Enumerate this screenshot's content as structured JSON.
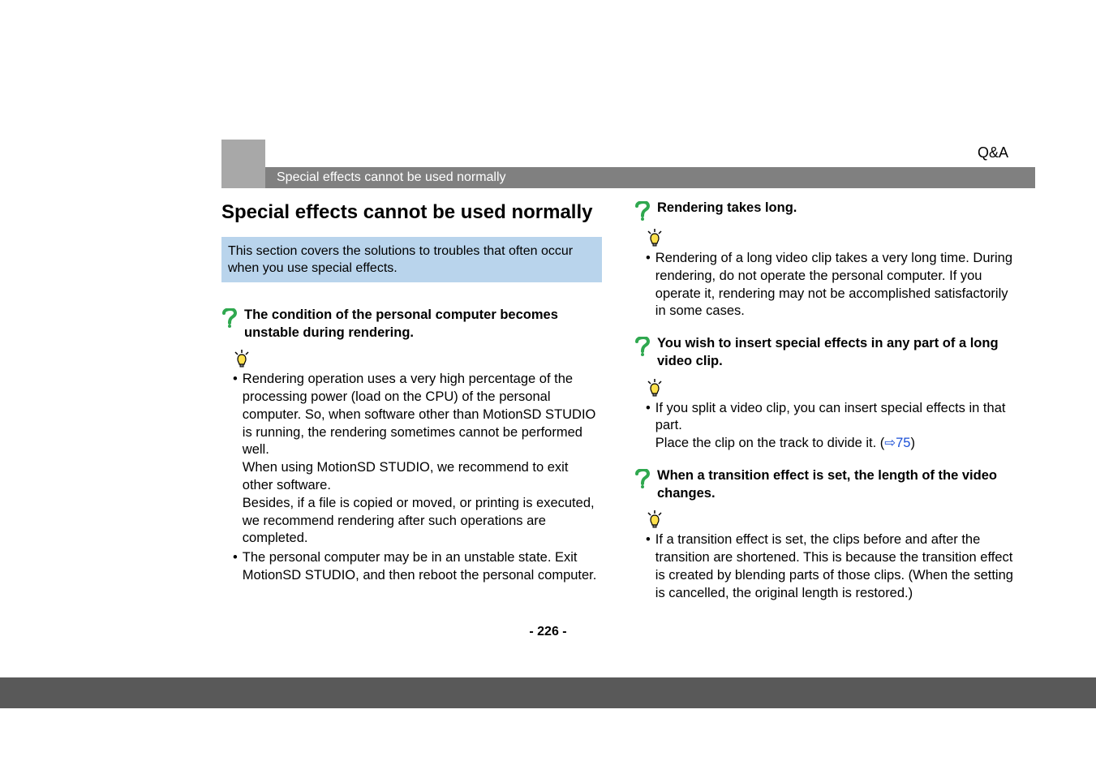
{
  "category_label": "Q&A",
  "header_bar_title": "Special effects cannot be used normally",
  "page_number": "- 226 -",
  "left": {
    "heading": "Special effects cannot be used normally",
    "intro": "This section covers the solutions to troubles that often occur when you use special effects.",
    "q1": "The condition of the personal computer becomes unstable during rendering.",
    "a1_b1_p1": "Rendering operation uses a very high percentage of the processing power (load on the CPU) of the personal computer. So, when software other than MotionSD STUDIO is running, the rendering sometimes cannot be performed well.",
    "a1_b1_p2": "When using MotionSD STUDIO, we recommend to exit other software.",
    "a1_b1_p3": "Besides, if a file is copied or moved, or printing is executed, we recommend rendering after such operations are completed.",
    "a1_b2": "The personal computer may be in an unstable state. Exit MotionSD STUDIO, and then reboot the personal computer."
  },
  "right": {
    "q2": "Rendering takes long.",
    "a2_b1": "Rendering of a long video clip takes a very long time. During rendering, do not operate the personal computer. If you operate it, rendering may not be accomplished satisfactorily in some cases.",
    "q3": "You wish to insert special effects in any part of a long video clip.",
    "a3_b1_p1": "If you split a video clip, you can insert special effects in that part.",
    "a3_b1_p2_pre": "Place the clip on the track to divide it. (",
    "a3_link_arrow": "⇨",
    "a3_link_num": "75",
    "a3_b1_p2_post": ")",
    "q4": "When a transition effect is set, the length of the video changes.",
    "a4_b1": "If a transition effect is set, the clips before and after the transition are shortened. This is because the transition effect is created by blending parts of those clips. (When the setting is cancelled, the original length is restored.)"
  }
}
